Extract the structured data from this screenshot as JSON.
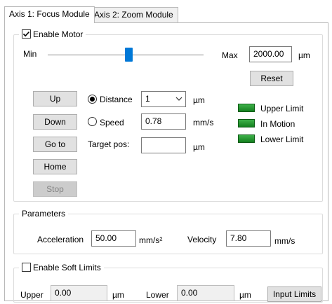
{
  "tabs": [
    "Axis 1: Focus Module",
    "Axis 2: Zoom Module"
  ],
  "motor": {
    "enable_label": "Enable Motor",
    "enabled": true,
    "min_label": "Min",
    "max_label": "Max",
    "max_value": "2000.00",
    "max_unit": "µm",
    "slider_fraction": 0.52,
    "reset_label": "Reset"
  },
  "buttons": {
    "up": "Up",
    "down": "Down",
    "goto": "Go to",
    "home": "Home",
    "stop": "Stop"
  },
  "move": {
    "distance_label": "Distance",
    "distance_value": "1",
    "distance_unit": "µm",
    "speed_label": "Speed",
    "speed_value": "0.78",
    "speed_unit": "mm/s",
    "target_label": "Target pos:",
    "target_value": "",
    "target_unit": "µm",
    "selected_mode": "distance"
  },
  "indicators": [
    {
      "label": "Upper Limit",
      "color": "#1f9a2c"
    },
    {
      "label": "In Motion",
      "color": "#1f9a2c"
    },
    {
      "label": "Lower Limit",
      "color": "#1f9a2c"
    }
  ],
  "parameters": {
    "title": "Parameters",
    "accel_label": "Acceleration",
    "accel_value": "50.00",
    "accel_unit": "mm/s²",
    "velocity_label": "Velocity",
    "velocity_value": "7.80",
    "velocity_unit": "mm/s"
  },
  "soft_limits": {
    "enable_label": "Enable Soft Limits",
    "enabled": false,
    "upper_label": "Upper",
    "upper_value": "0.00",
    "upper_unit": "µm",
    "lower_label": "Lower",
    "lower_value": "0.00",
    "lower_unit": "µm",
    "input_button": "Input Limits"
  }
}
